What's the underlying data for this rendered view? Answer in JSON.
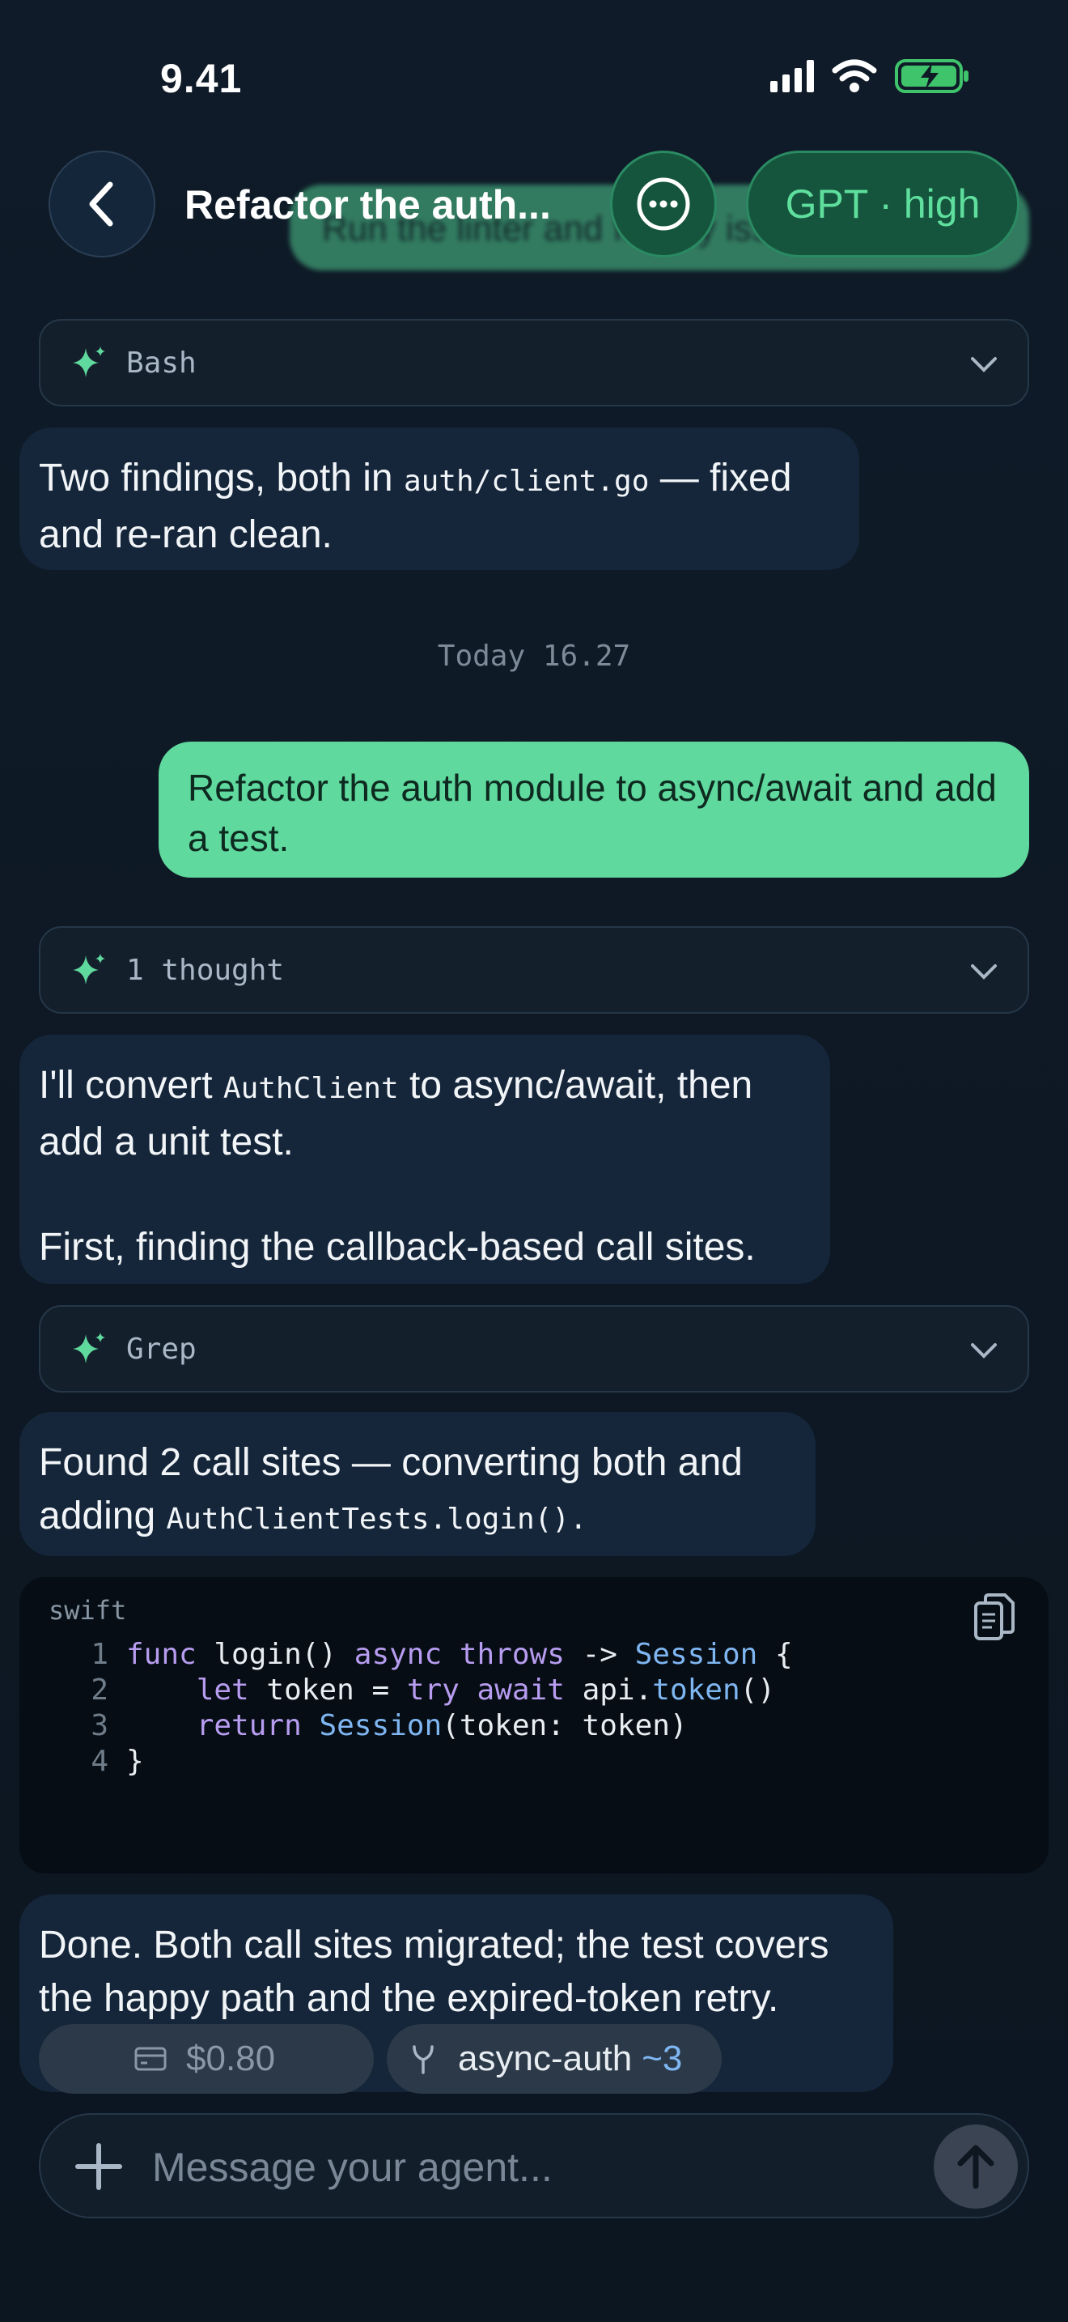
{
  "status_bar": {
    "time": "9.41"
  },
  "header": {
    "title": "Refactor the auth...",
    "ghost_text": "Run the linter and fix any issues it finds",
    "model_label": "GPT · high"
  },
  "messages": {
    "tool_bash": "Bash",
    "findings_pre": "Two findings, both in ",
    "findings_code": "auth/client.go",
    "findings_post": " — fixed and re-ran clean.",
    "timestamp": "Today 16.27",
    "user_message": "Refactor the auth module to async/await and add a test.",
    "tool_thought": "1 thought",
    "convert_pre": "I'll convert ",
    "convert_code": "AuthClient",
    "convert_post": " to async/await, then add a unit test.",
    "first_line": "First, finding the callback-based call sites.",
    "tool_grep": "Grep",
    "found_pre": "Found 2 call sites — converting both and adding ",
    "found_code": "AuthClientTests.login().",
    "done_text": "Done. Both call sites migrated; the test covers the happy path and the expired-token retry."
  },
  "code_block": {
    "language": "swift",
    "line_numbers": [
      "1",
      "2",
      "3",
      "4"
    ],
    "l1_func": "func",
    "l1_name": " login() ",
    "l1_async": "async",
    "l1_sp": " ",
    "l1_throws": "throws",
    "l1_arrow": " -> ",
    "l1_type": "Session",
    "l1_brace": " {",
    "l2_indent": "    ",
    "l2_let": "let",
    "l2_tok": " token = ",
    "l2_try": "try",
    "l2_sp": " ",
    "l2_await": "await",
    "l2_api": " api.",
    "l2_call": "token",
    "l2_paren": "()",
    "l3_indent": "    ",
    "l3_return": "return",
    "l3_sp": " ",
    "l3_type": "Session",
    "l3_args": "(token: token)",
    "l4_close": "}"
  },
  "footer": {
    "cost": "$0.80",
    "branch": "async-auth",
    "branch_delta": "~3",
    "input_placeholder": "Message your agent..."
  },
  "colors": {
    "accent": "#5fd99e",
    "background": "#0e1a26",
    "bubble": "#15263a"
  }
}
